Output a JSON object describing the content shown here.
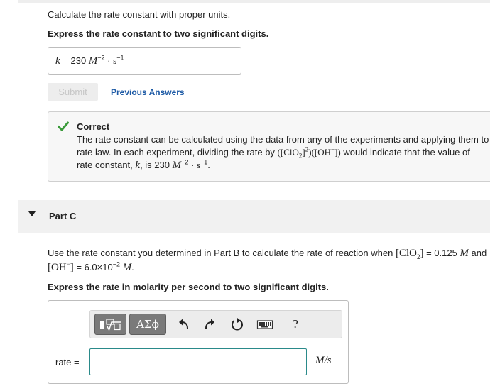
{
  "part_b": {
    "instruction": "Calculate the rate constant with proper units.",
    "express": "Express the rate constant to two significant digits.",
    "answer": {
      "var": "k",
      "eq": " = 230 ",
      "unit_m": "M",
      "exp_m": "−2",
      "dot": " · ",
      "unit_s": "s",
      "exp_s": "−1"
    },
    "submit_label": "Submit",
    "previous_answers_label": "Previous Answers",
    "feedback": {
      "title": "Correct",
      "line1": "The rate constant can be calculated using the data from any of the experiments and applying them to",
      "line2_a": "rate law. In each experiment, dividing the rate by ",
      "line2_b": " would indicate that the value of",
      "line3_a": "rate constant, ",
      "line3_var": "k",
      "line3_b": ", is 230 "
    }
  },
  "part_c": {
    "title": "Part C",
    "question_a": "Use the rate constant you determined in Part B to calculate the rate of reaction when ",
    "question_b": " = 0.125 ",
    "question_m": "M",
    "question_and": " and",
    "question_c": " = 6.0×10",
    "question_exp": "−2",
    "express": "Express the rate in molarity per second to two significant digits.",
    "toolbar": {
      "greek_label": "ΑΣϕ",
      "help_label": "?"
    },
    "input_label": "rate =",
    "input_value": "",
    "unit": "M/s"
  },
  "colors": {
    "link": "#1d5aa5",
    "check": "#3a9a3a",
    "input_border": "#2a8a8a"
  },
  "icons": [
    "check-icon",
    "templates-icon",
    "sqrt-icon",
    "greek-letters-icon",
    "undo-icon",
    "redo-icon",
    "reset-icon",
    "keyboard-icon",
    "help-icon",
    "expand-triangle-icon"
  ]
}
